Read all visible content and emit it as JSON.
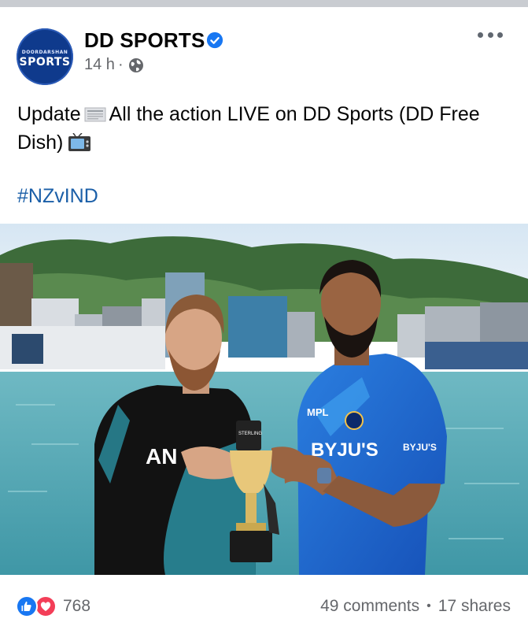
{
  "post": {
    "author": {
      "name": "DD SPORTS",
      "avatar_small_text": "DOORDARSHAN",
      "avatar_main_text": "SPORTS",
      "verified_icon": "verified-badge-icon"
    },
    "timestamp": "14 h",
    "separator": "·",
    "audience_icon": "globe-icon",
    "more_icon": "more-options-icon",
    "text": {
      "part1": "Update",
      "emoji1": "newspaper-emoji",
      "part2": "All the action LIVE on DD Sports (DD Free Dish)",
      "emoji2": "television-emoji"
    },
    "hashtag": "#NZvIND",
    "image": {
      "jersey_left_text": "AN",
      "jersey_right_brand": "BYJU'S",
      "jersey_right_sleeve": "BYJU'S",
      "jersey_right_sponsor": "MPL",
      "trophy_tag": "STERLING"
    }
  },
  "engagement": {
    "reaction_icons": [
      "like-icon",
      "love-icon"
    ],
    "reaction_count": "768",
    "comments": "49 comments",
    "stat_separator": "•",
    "shares": "17 shares"
  },
  "colors": {
    "like_blue": "#1877f2",
    "love_red": "#f33e58",
    "hashtag_blue": "#1b5fa8",
    "secondary_text": "#65676b",
    "avatar_navy": "#0f3a8c"
  }
}
